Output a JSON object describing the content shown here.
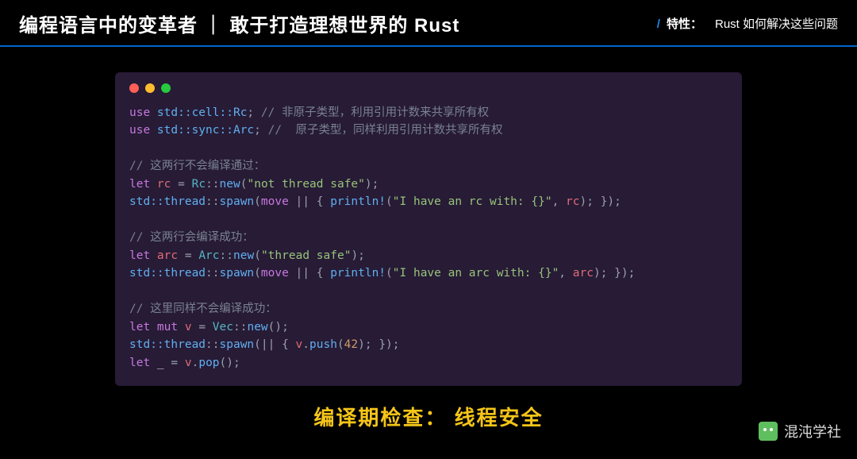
{
  "header": {
    "title": "编程语言中的变革者 ｜ 敢于打造理想世界的 Rust",
    "label_prefix": "/",
    "label": "特性：",
    "subtitle": "Rust 如何解决这些问题"
  },
  "code": {
    "l1_kw": "use",
    "l1_path": " std::cell::Rc",
    "l1_sc": ";",
    "l1_cm": " // 非原子类型，利用引用计数来共享所有权",
    "l2_kw": "use",
    "l2_path": " std::sync::Arc",
    "l2_sc": ";",
    "l2_cm": " //  原子类型，同样利用引用计数共享所有权",
    "blk1_cm": "// 这两行不会编译通过：",
    "l3_let": "let",
    "l3_var": " rc",
    "l3_eq": " = ",
    "l3_ty": "Rc",
    "l3_ns": "::",
    "l3_fn": "new",
    "l3_op": "(",
    "l3_str": "\"not thread safe\"",
    "l3_cl": ");",
    "l4_path": "std::thread",
    "l4_ns": "::",
    "l4_fn": "spawn",
    "l4_op": "(",
    "l4_mv": "move",
    "l4_bar": " || { ",
    "l4_mac": "println!",
    "l4_op2": "(",
    "l4_str": "\"I have an rc with: {}\"",
    "l4_cm": ", ",
    "l4_var": "rc",
    "l4_cl": "); });",
    "blk2_cm": "// 这两行会编译成功：",
    "l5_let": "let",
    "l5_var": " arc",
    "l5_eq": " = ",
    "l5_ty": "Arc",
    "l5_ns": "::",
    "l5_fn": "new",
    "l5_op": "(",
    "l5_str": "\"thread safe\"",
    "l5_cl": ");",
    "l6_path": "std::thread",
    "l6_ns": "::",
    "l6_fn": "spawn",
    "l6_op": "(",
    "l6_mv": "move",
    "l6_bar": " || { ",
    "l6_mac": "println!",
    "l6_op2": "(",
    "l6_str": "\"I have an arc with: {}\"",
    "l6_cm": ", ",
    "l6_var": "arc",
    "l6_cl": "); });",
    "blk3_cm": "// 这里同样不会编译成功：",
    "l7_let": "let",
    "l7_mut": " mut",
    "l7_var": " v",
    "l7_eq": " = ",
    "l7_ty": "Vec",
    "l7_ns": "::",
    "l7_fn": "new",
    "l7_cl": "();",
    "l8_path": "std::thread",
    "l8_ns": "::",
    "l8_fn": "spawn",
    "l8_op": "(|| { ",
    "l8_var": "v",
    "l8_dot": ".",
    "l8_m": "push",
    "l8_op2": "(",
    "l8_num": "42",
    "l8_cl": "); });",
    "l9_let": "let",
    "l9_us": " _",
    "l9_eq": " = ",
    "l9_var": "v",
    "l9_dot": ".",
    "l9_m": "pop",
    "l9_cl": "();"
  },
  "footer": {
    "title": "编译期检查： 线程安全"
  },
  "brand": {
    "name": "混沌学社"
  }
}
